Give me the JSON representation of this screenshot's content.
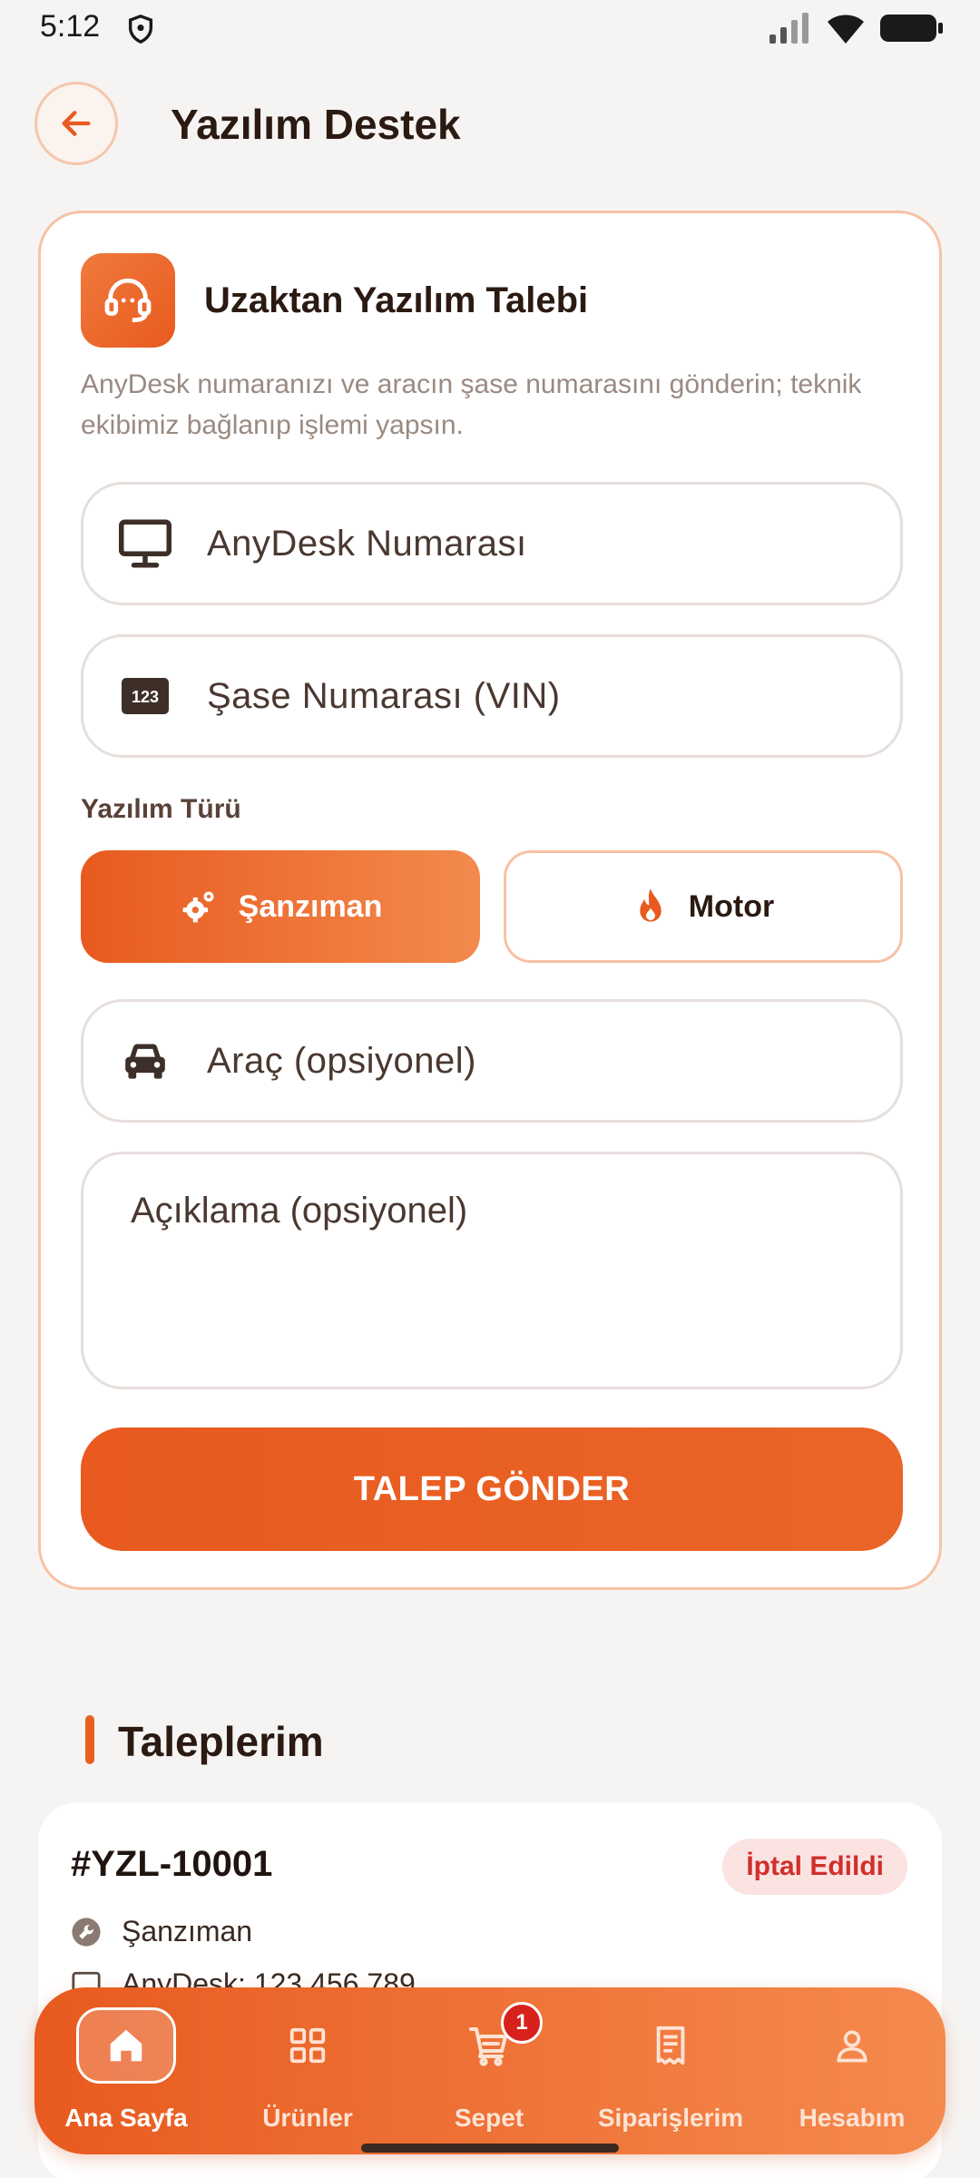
{
  "status_bar": {
    "time": "5:12"
  },
  "header": {
    "title": "Yazılım Destek"
  },
  "form": {
    "title": "Uzaktan Yazılım Talebi",
    "description": "AnyDesk numaranızı ve aracın şase numarasını gönderin; teknik ekibimiz bağlanıp işlemi yapsın.",
    "anydesk_placeholder": "AnyDesk Numarası",
    "vin_placeholder": "Şase Numarası (VIN)",
    "software_type_label": "Yazılım Türü",
    "type_options": [
      "Şanzıman",
      "Motor"
    ],
    "selected_type": "Şanzıman",
    "vehicle_placeholder": "Araç (opsiyonel)",
    "description_placeholder": "Açıklama (opsiyonel)",
    "submit_label": "TALEP GÖNDER"
  },
  "requests": {
    "title": "Taleplerim",
    "items": [
      {
        "id": "#YZL-10001",
        "status": "İptal Edildi",
        "type": "Şanzıman",
        "anydesk": "AnyDesk: 123 456 789"
      }
    ]
  },
  "bottom_nav": {
    "items": [
      {
        "label": "Ana Sayfa",
        "icon": "home-icon",
        "active": true
      },
      {
        "label": "Ürünler",
        "icon": "grid-icon",
        "active": false
      },
      {
        "label": "Sepet",
        "icon": "cart-icon",
        "active": false,
        "badge": "1"
      },
      {
        "label": "Siparişlerim",
        "icon": "receipt-icon",
        "active": false
      },
      {
        "label": "Hesabım",
        "icon": "person-icon",
        "active": false
      }
    ]
  },
  "colors": {
    "accent": "#e85a1f",
    "accent_light": "#f38a4d",
    "badge_cancelled_bg": "#fbe3e2",
    "badge_cancelled_text": "#d12f2a",
    "background": "#f6f4f2"
  }
}
